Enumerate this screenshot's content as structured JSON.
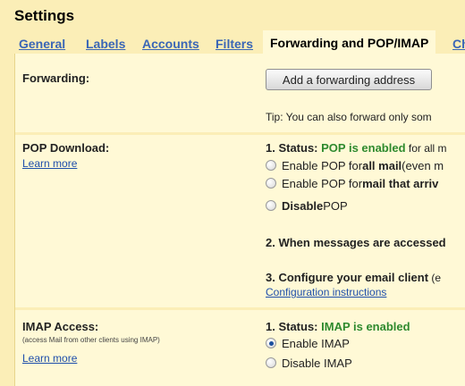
{
  "settings": {
    "title": "Settings"
  },
  "tabs": [
    {
      "label": "General"
    },
    {
      "label": "Labels"
    },
    {
      "label": "Accounts"
    },
    {
      "label": "Filters"
    },
    {
      "label": "Forwarding and POP/IMAP"
    },
    {
      "label": "Ch"
    }
  ],
  "forwarding": {
    "title": "Forwarding:",
    "button_label": "Add a forwarding address",
    "tip": "Tip: You can also forward only som"
  },
  "pop": {
    "title": "POP Download:",
    "learn_more": "Learn more",
    "status_prefix": "1. Status: ",
    "status_value": "POP is enabled",
    "status_suffix": " for all m",
    "options": [
      {
        "pre": "Enable POP for ",
        "bold": "all mail",
        "post": " (even m",
        "checked": false
      },
      {
        "pre": "Enable POP for ",
        "bold": "mail that arriv",
        "post": "",
        "checked": false
      },
      {
        "pre": "",
        "bold": "Disable",
        "post": " POP",
        "checked": false
      }
    ],
    "step2": "2. When messages are accessed",
    "step3_bold": "3. Configure your email client",
    "step3_rest": " (e",
    "config_link": "Configuration instructions"
  },
  "imap": {
    "title": "IMAP Access:",
    "subtitle": "(access Mail from other clients using IMAP)",
    "learn_more": "Learn more",
    "status_prefix": "1. Status: ",
    "status_value": "IMAP is enabled",
    "options": [
      {
        "label": "Enable IMAP",
        "checked": true
      },
      {
        "label": "Disable IMAP",
        "checked": false
      }
    ]
  },
  "colors": {
    "background": "#fbeeb7",
    "panel": "#fff9d6",
    "link": "#3a66b6",
    "status_green": "#2e8a2e"
  }
}
